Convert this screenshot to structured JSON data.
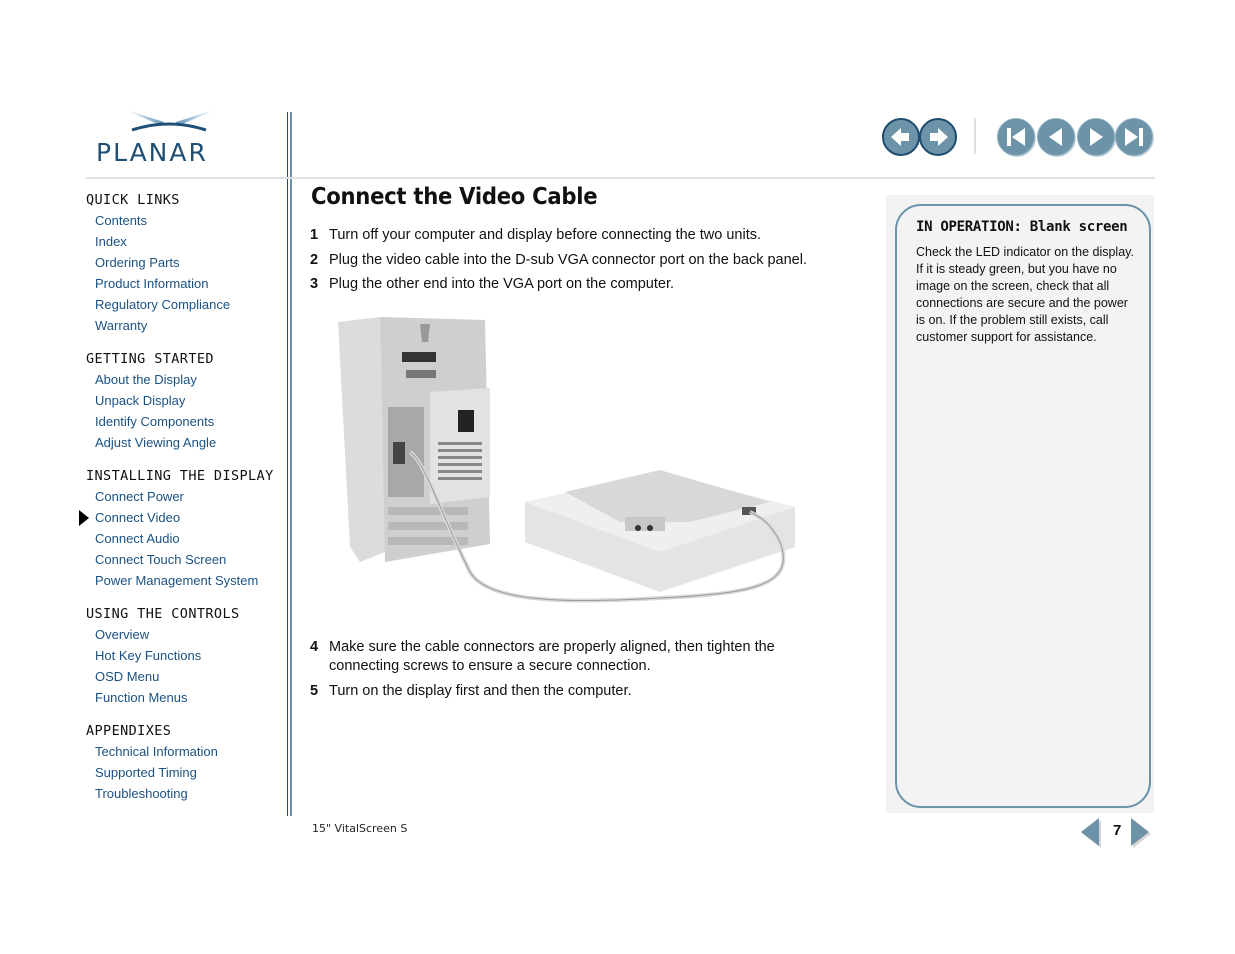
{
  "brand": {
    "logo_text": "PLANAR",
    "accent": "#1f4f74",
    "button_color": "#6d93a8"
  },
  "toolbar": {
    "history_buttons": [
      {
        "name": "back",
        "icon": "arrow-left-icon"
      },
      {
        "name": "forward",
        "icon": "arrow-right-icon"
      }
    ],
    "page_buttons": [
      {
        "name": "first-page",
        "icon": "skip-first-icon"
      },
      {
        "name": "previous-page",
        "icon": "triangle-left-icon"
      },
      {
        "name": "next-page",
        "icon": "triangle-right-icon"
      },
      {
        "name": "last-page",
        "icon": "skip-last-icon"
      }
    ]
  },
  "sidebar": {
    "sections": [
      {
        "title": "QUICK LINKS",
        "items": [
          "Contents",
          "Index",
          "Ordering Parts",
          "Product Information",
          "Regulatory Compliance",
          "Warranty"
        ]
      },
      {
        "title": "GETTING STARTED",
        "items": [
          "About the Display",
          "Unpack Display",
          "Identify Components",
          "Adjust Viewing Angle"
        ]
      },
      {
        "title": "INSTALLING THE DISPLAY",
        "items": [
          "Connect Power",
          "Connect Video",
          "Connect Audio",
          "Connect Touch Screen",
          "Power Management System"
        ]
      },
      {
        "title": "USING THE CONTROLS",
        "items": [
          "Overview",
          "Hot Key Functions",
          "OSD Menu",
          "Function Menus"
        ]
      },
      {
        "title": "APPENDIXES",
        "items": [
          "Technical Information",
          "Supported Timing",
          "Troubleshooting"
        ]
      }
    ],
    "current_item": "Connect Video"
  },
  "main": {
    "title": "Connect the Video Cable",
    "steps": [
      {
        "num": "1",
        "text": "Turn off your computer and display before connecting the two units."
      },
      {
        "num": "2",
        "text": "Plug the video cable into the D-sub VGA connector port on the back panel."
      },
      {
        "num": "3",
        "text": "Plug the other end into the VGA port on the computer."
      },
      {
        "num": "4",
        "text": "Make sure the cable connectors are properly aligned, then tighten the connecting screws to ensure a secure connection."
      },
      {
        "num": "5",
        "text": "Turn on the display first and then the computer."
      }
    ],
    "illustration_alt": "Computer tower connected by VGA cable to the back of a flat panel display"
  },
  "callout": {
    "title": "IN OPERATION: Blank screen",
    "body": "Check the LED indicator on the display. If it is steady green, but you have no image on the screen, check that all connections are secure and the power is on. If the problem still exists, call customer support for assistance."
  },
  "footer": {
    "product": "15\" VitalScreen S",
    "page_number": "7"
  }
}
